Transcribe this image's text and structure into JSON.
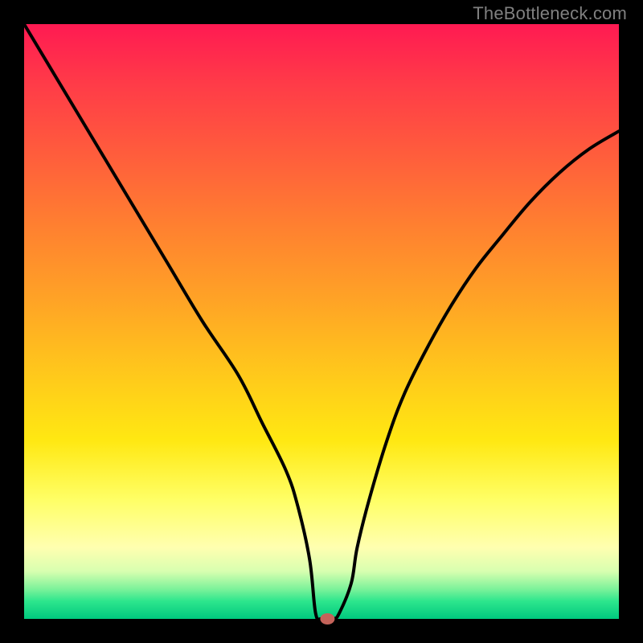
{
  "watermark": {
    "text": "TheBottleneck.com"
  },
  "chart_data": {
    "type": "line",
    "title": "",
    "xlabel": "",
    "ylabel": "",
    "xlim": [
      0,
      100
    ],
    "ylim": [
      0,
      100
    ],
    "grid": false,
    "series": [
      {
        "name": "bottleneck-curve",
        "x": [
          0,
          6,
          12,
          18,
          24,
          30,
          36,
          40,
          44,
          46,
          48,
          49,
          50,
          52,
          53,
          55,
          56,
          58,
          61,
          64,
          68,
          72,
          76,
          80,
          85,
          90,
          95,
          100
        ],
        "values": [
          100,
          90,
          80,
          70,
          60,
          50,
          41,
          33,
          25,
          19,
          10,
          1,
          0,
          0,
          1,
          6,
          12,
          20,
          30,
          38,
          46,
          53,
          59,
          64,
          70,
          75,
          79,
          82
        ]
      }
    ],
    "marker": {
      "x": 51,
      "y": 0,
      "color": "#c4635a",
      "rx": 9,
      "ry": 7
    },
    "colors": {
      "curve": "#000000",
      "marker": "#c4635a",
      "frame_bg": "#000000"
    }
  }
}
